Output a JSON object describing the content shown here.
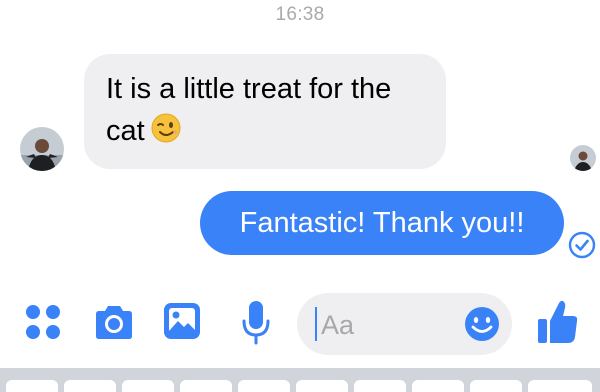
{
  "conversation": {
    "timestamp": "16:38",
    "messages": [
      {
        "direction": "incoming",
        "text": "It is a little treat for the cat",
        "emoji": "winking-face"
      },
      {
        "direction": "outgoing",
        "text": "Fantastic! Thank you!!",
        "status": "sent"
      }
    ]
  },
  "composer": {
    "placeholder": "Aa",
    "icons": [
      "more-actions-icon",
      "camera-icon",
      "image-icon",
      "microphone-icon",
      "emoji-icon",
      "thumbs-up-icon"
    ]
  },
  "colors": {
    "accent": "#3a82f7",
    "incoming_bubble": "#efeff1",
    "timestamp": "#a9a9ae"
  }
}
